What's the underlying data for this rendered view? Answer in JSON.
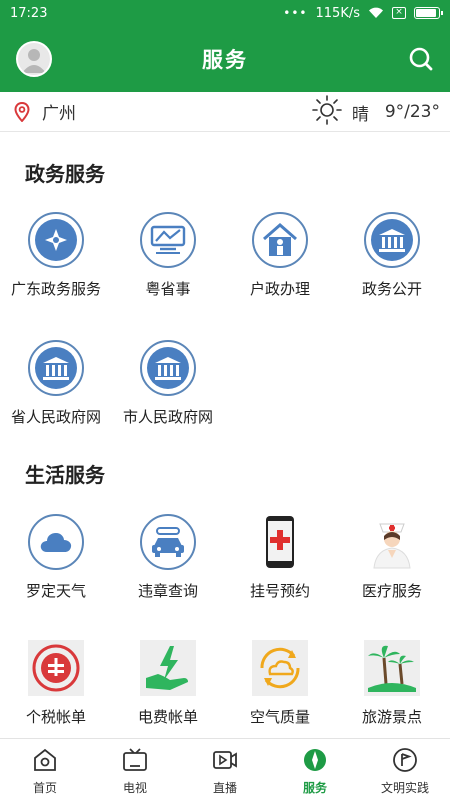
{
  "status": {
    "time": "17:23",
    "speed": "115K/s"
  },
  "header": {
    "title": "服务"
  },
  "location": {
    "city": "广州"
  },
  "weather": {
    "condition": "晴",
    "temp": "9°/23°"
  },
  "sections": {
    "gov": {
      "title": "政务服务",
      "items": [
        {
          "label": "广东政务服务"
        },
        {
          "label": "粤省事"
        },
        {
          "label": "户政办理"
        },
        {
          "label": "政务公开"
        },
        {
          "label": "省人民政府网"
        },
        {
          "label": "市人民政府网"
        }
      ]
    },
    "life": {
      "title": "生活服务",
      "items": [
        {
          "label": "罗定天气"
        },
        {
          "label": "违章查询"
        },
        {
          "label": "挂号预约"
        },
        {
          "label": "医疗服务"
        },
        {
          "label": "个税帐单"
        },
        {
          "label": "电费帐单"
        },
        {
          "label": "空气质量"
        },
        {
          "label": "旅游景点"
        }
      ]
    }
  },
  "tabs": [
    {
      "label": "首页"
    },
    {
      "label": "电视"
    },
    {
      "label": "直播"
    },
    {
      "label": "服务"
    },
    {
      "label": "文明实践"
    }
  ],
  "colors": {
    "brand_green": "#1e9b45",
    "icon_blue": "#4a7fc1"
  }
}
